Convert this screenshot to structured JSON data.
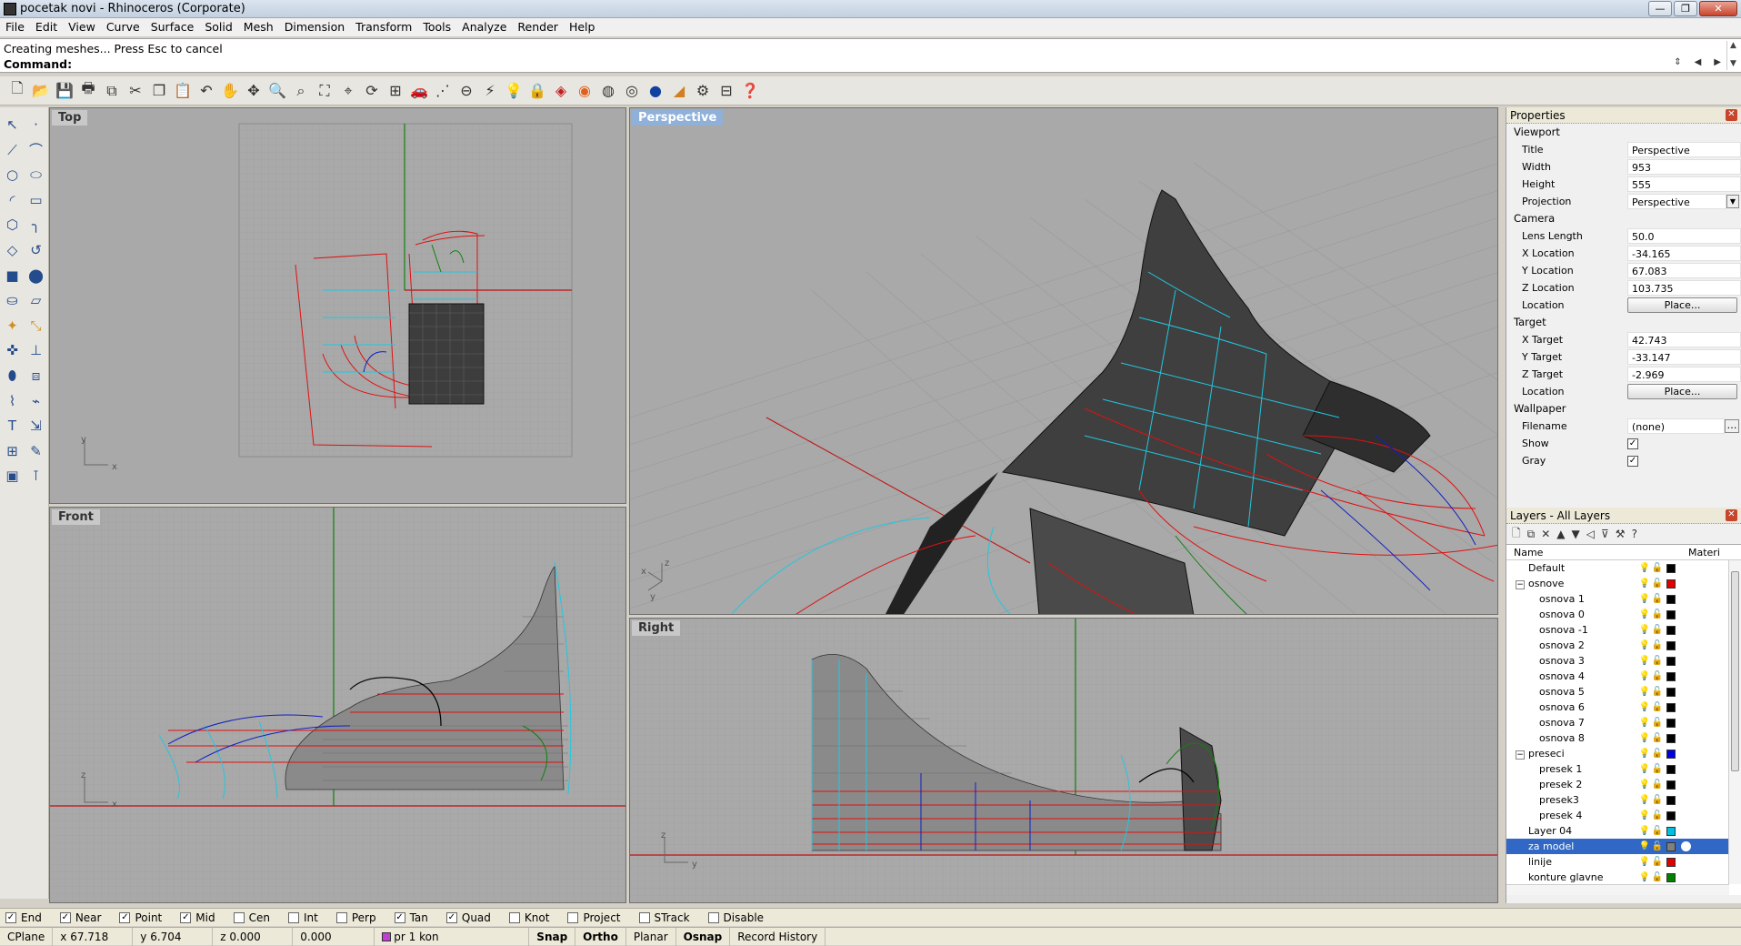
{
  "window": {
    "title": "pocetak novi - Rhinoceros (Corporate)",
    "min": "—",
    "max": "❐",
    "close": "✕"
  },
  "menu": [
    "File",
    "Edit",
    "View",
    "Curve",
    "Surface",
    "Solid",
    "Mesh",
    "Dimension",
    "Transform",
    "Tools",
    "Analyze",
    "Render",
    "Help"
  ],
  "command": {
    "history": "Creating meshes... Press Esc to cancel",
    "prompt": "Command:",
    "value": ""
  },
  "viewports": {
    "top": "Top",
    "perspective": "Perspective",
    "front": "Front",
    "right": "Right"
  },
  "properties": {
    "title": "Properties",
    "viewport_section": "Viewport",
    "vp_rows": [
      [
        "Title",
        "Perspective"
      ],
      [
        "Width",
        "953"
      ],
      [
        "Height",
        "555"
      ],
      [
        "Projection",
        "Perspective"
      ]
    ],
    "camera_section": "Camera",
    "cam_rows": [
      [
        "Lens Length",
        "50.0"
      ],
      [
        "X Location",
        "-34.165"
      ],
      [
        "Y Location",
        "67.083"
      ],
      [
        "Z Location",
        "103.735"
      ]
    ],
    "location_label": "Location",
    "place_btn": "Place...",
    "target_section": "Target",
    "tgt_rows": [
      [
        "X Target",
        "42.743"
      ],
      [
        "Y Target",
        "-33.147"
      ],
      [
        "Z Target",
        "-2.969"
      ]
    ],
    "wallpaper_section": "Wallpaper",
    "filename_label": "Filename",
    "filename_value": "(none)",
    "show_label": "Show",
    "gray_label": "Gray"
  },
  "layers": {
    "title": "Layers - All Layers",
    "col_name": "Name",
    "col_material": "Materi",
    "rows": [
      {
        "name": "Default",
        "indent": 1,
        "color": "#000000"
      },
      {
        "name": "osnove",
        "indent": 0,
        "expander": "−",
        "color": "#e00000"
      },
      {
        "name": "osnova 1",
        "indent": 2,
        "color": "#000000"
      },
      {
        "name": "osnova 0",
        "indent": 2,
        "color": "#000000"
      },
      {
        "name": "osnova -1",
        "indent": 2,
        "color": "#000000"
      },
      {
        "name": "osnova 2",
        "indent": 2,
        "color": "#000000"
      },
      {
        "name": "osnova 3",
        "indent": 2,
        "color": "#000000"
      },
      {
        "name": "osnova 4",
        "indent": 2,
        "color": "#000000"
      },
      {
        "name": "osnova 5",
        "indent": 2,
        "color": "#000000"
      },
      {
        "name": "osnova 6",
        "indent": 2,
        "color": "#000000"
      },
      {
        "name": "osnova 7",
        "indent": 2,
        "color": "#000000"
      },
      {
        "name": "osnova 8",
        "indent": 2,
        "color": "#000000"
      },
      {
        "name": "preseci",
        "indent": 0,
        "expander": "−",
        "color": "#0000e0"
      },
      {
        "name": "presek 1",
        "indent": 2,
        "color": "#000000"
      },
      {
        "name": "presek 2",
        "indent": 2,
        "color": "#000000"
      },
      {
        "name": "presek3",
        "indent": 2,
        "color": "#000000"
      },
      {
        "name": "presek 4",
        "indent": 2,
        "color": "#000000"
      },
      {
        "name": "Layer 04",
        "indent": 1,
        "color": "#00c0e0"
      },
      {
        "name": "za model",
        "indent": 1,
        "color": "#808080",
        "selected": true
      },
      {
        "name": "linije",
        "indent": 1,
        "color": "#e00000"
      },
      {
        "name": "konture glavne",
        "indent": 1,
        "color": "#008000"
      }
    ]
  },
  "osnap": [
    {
      "label": "End",
      "checked": true
    },
    {
      "label": "Near",
      "checked": true
    },
    {
      "label": "Point",
      "checked": true
    },
    {
      "label": "Mid",
      "checked": true
    },
    {
      "label": "Cen",
      "checked": false
    },
    {
      "label": "Int",
      "checked": false
    },
    {
      "label": "Perp",
      "checked": false
    },
    {
      "label": "Tan",
      "checked": true
    },
    {
      "label": "Quad",
      "checked": true
    },
    {
      "label": "Knot",
      "checked": false
    },
    {
      "label": "Project",
      "checked": false
    },
    {
      "label": "STrack",
      "checked": false
    },
    {
      "label": "Disable",
      "checked": false
    }
  ],
  "status": {
    "cplane": "CPlane",
    "x": "x 67.718",
    "y": "y 6.704",
    "z": "z 0.000",
    "d": "0.000",
    "layer": "pr 1 kon",
    "snap": "Snap",
    "ortho": "Ortho",
    "planar": "Planar",
    "osnap": "Osnap",
    "record": "Record History"
  },
  "colors": {
    "curve_red": "#e01010",
    "curve_cyan": "#20c8e0",
    "curve_blue": "#1020c0",
    "surface_dark": "#3a3a3a",
    "grid": "#9c9c9c",
    "vp_bg": "#a9a9a9",
    "selection": "#3168c5"
  }
}
